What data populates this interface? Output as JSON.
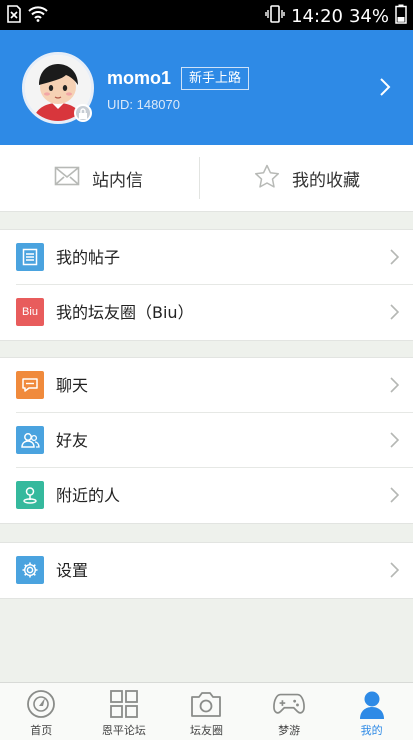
{
  "status_bar": {
    "time": "14:20",
    "battery": "34%"
  },
  "profile": {
    "username": "momo1",
    "level_badge": "新手上路",
    "uid": "UID: 148070"
  },
  "quick_actions": [
    {
      "label": "站内信",
      "icon": "envelope-icon"
    },
    {
      "label": "我的收藏",
      "icon": "star-icon"
    }
  ],
  "menu_groups": [
    [
      {
        "label": "我的帖子",
        "icon": "post-list-icon",
        "color": "#4aa3df"
      },
      {
        "label": "我的坛友圈（Biu）",
        "icon": "biu-icon",
        "icon_text": "Biu",
        "color": "#e85c5c"
      }
    ],
    [
      {
        "label": "聊天",
        "icon": "chat-icon",
        "color": "#f08a3c"
      },
      {
        "label": "好友",
        "icon": "friends-icon",
        "color": "#4aa3df"
      },
      {
        "label": "附近的人",
        "icon": "location-pin-icon",
        "color": "#35b99d"
      }
    ],
    [
      {
        "label": "设置",
        "icon": "gear-icon",
        "color": "#4aa3df"
      }
    ]
  ],
  "bottom_nav": [
    {
      "label": "首页",
      "icon": "home-compass-icon",
      "active": false
    },
    {
      "label": "恩平论坛",
      "icon": "grid-icon",
      "active": false
    },
    {
      "label": "坛友圈",
      "icon": "camera-icon",
      "active": false
    },
    {
      "label": "梦游",
      "icon": "gamepad-icon",
      "active": false
    },
    {
      "label": "我的",
      "icon": "user-icon",
      "active": true
    }
  ],
  "colors": {
    "header_blue": "#2e8ae6",
    "active_tab": "#2e8ae6"
  }
}
